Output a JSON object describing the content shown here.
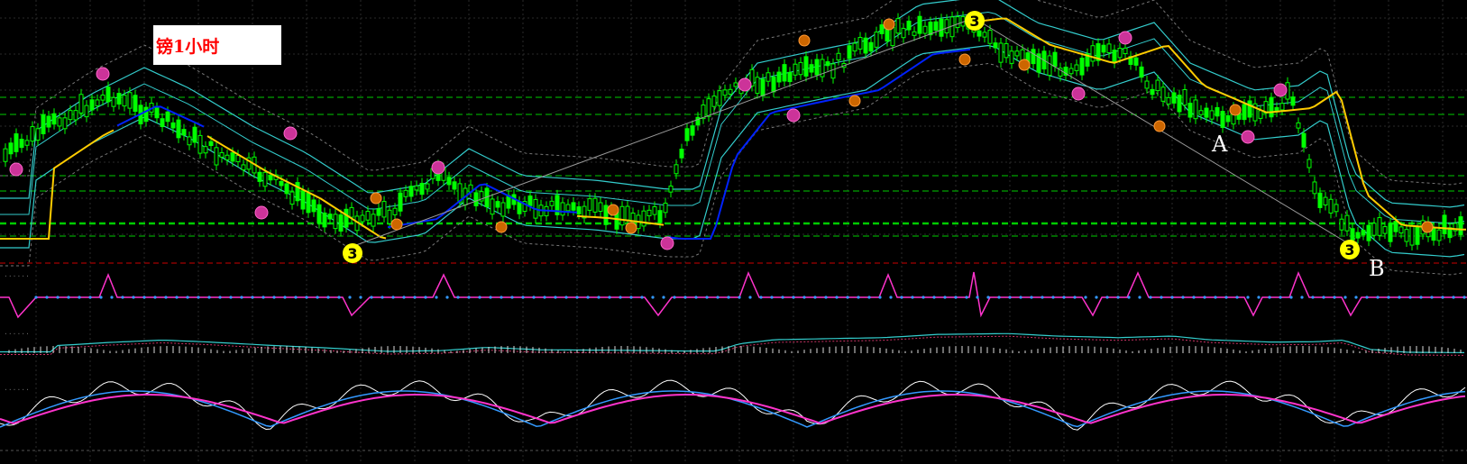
{
  "chart_data": {
    "type": "candlestick",
    "title": "镑1小时",
    "annotations": {
      "point_a": "A",
      "point_b": "B",
      "wave_label": "3"
    },
    "indicators": {
      "sub1": "......",
      "sub2": "......",
      "sub3": "......"
    },
    "trend": "up to peak then down",
    "grid": true,
    "colors": {
      "background": "#000000",
      "grid": "#2a2a2a",
      "bull": "#00ff00",
      "bear": "#00ff00",
      "ma_yellow": "#ffcc00",
      "ma_blue": "#0022ff",
      "band_cyan": "#33cccc",
      "level_green": "#00cc00",
      "level_red": "#cc0000",
      "signal_pink": "#ff33cc",
      "signal_blue": "#3399ff"
    }
  }
}
